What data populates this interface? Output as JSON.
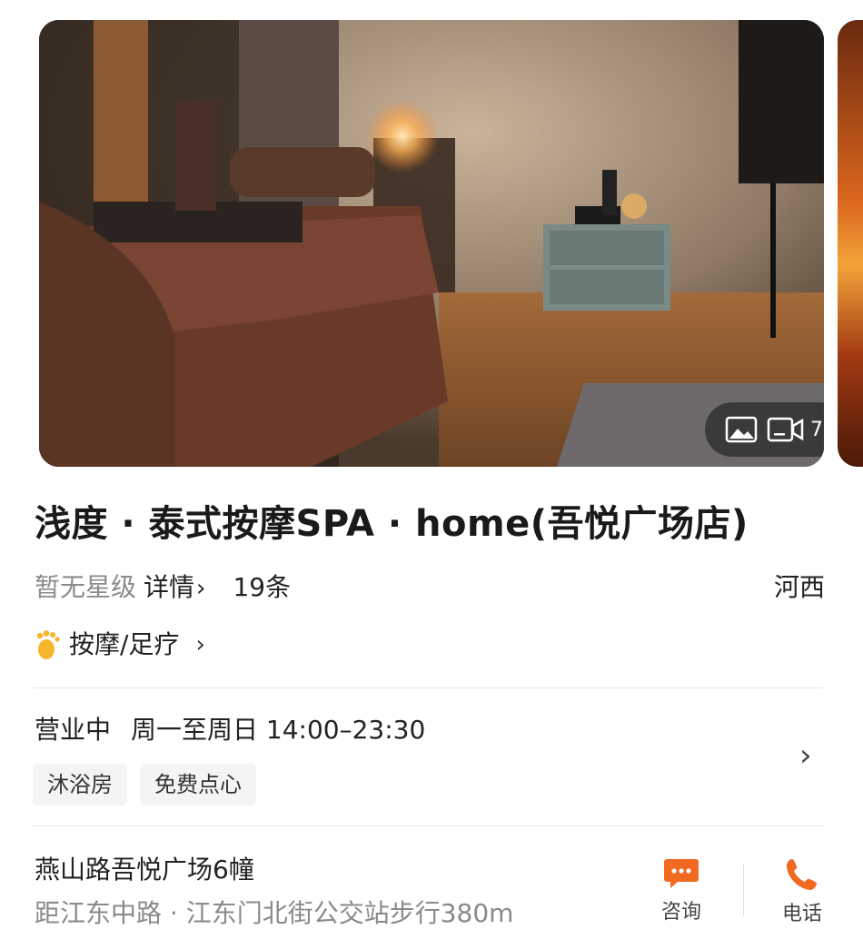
{
  "gallery": {
    "photo_alt": "spa room photo",
    "media_count": "7",
    "icons": [
      "image-icon",
      "video-icon"
    ]
  },
  "shop": {
    "title": "浅度 · 泰式按摩SPA · home(吾悦广场店)",
    "rating": "暂无星级",
    "details_link": "详情",
    "review_count": "19条",
    "area": "河西",
    "category": "按摩/足疗"
  },
  "hours": {
    "status": "营业中",
    "schedule": "周一至周日 14:00–23:30"
  },
  "tags": [
    "沐浴房",
    "免费点心"
  ],
  "location": {
    "address": "燕山路吾悦广场6幢",
    "distance": "距江东中路 · 江东门北街公交站步行380m"
  },
  "actions": {
    "consult_label": "咨询",
    "call_label": "电话"
  },
  "colors": {
    "accent": "#F26A21",
    "muted_text": "#8A8A8A",
    "tag_bg": "#F4F4F4"
  }
}
